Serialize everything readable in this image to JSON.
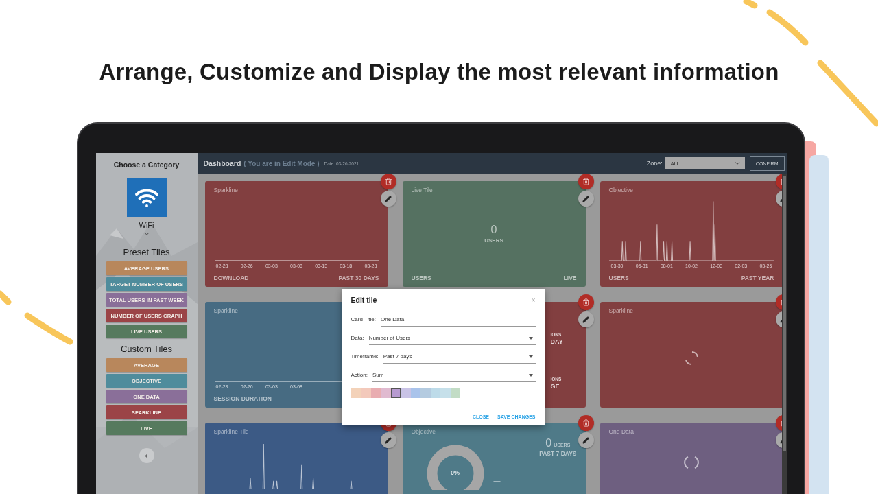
{
  "headline": "Arrange, Customize and Display the most relevant information",
  "sidebar": {
    "title": "Choose a Category",
    "category": "WiFi",
    "sections": [
      {
        "heading": "Preset Tiles",
        "tiles": [
          {
            "label": "AVERAGE USERS",
            "color": "#b8875c"
          },
          {
            "label": "TARGET NUMBER OF USERS",
            "color": "#4f8c9c"
          },
          {
            "label": "TOTAL USERS IN PAST WEEK",
            "color": "#8a6f99"
          },
          {
            "label": "NUMBER OF USERS GRAPH",
            "color": "#9b4447"
          },
          {
            "label": "LIVE USERS",
            "color": "#567a5e"
          }
        ]
      },
      {
        "heading": "Custom Tiles",
        "tiles": [
          {
            "label": "AVERAGE",
            "color": "#b8875c"
          },
          {
            "label": "OBJECTIVE",
            "color": "#4f8c9c"
          },
          {
            "label": "ONE DATA",
            "color": "#8a6f99"
          },
          {
            "label": "SPARKLINE",
            "color": "#9b4447"
          },
          {
            "label": "LIVE",
            "color": "#567a5e"
          }
        ]
      }
    ]
  },
  "header": {
    "title": "Dashboard",
    "mode_note": "( You are in Edit Mode )",
    "date": "Date: 03-26-2021",
    "zone_label": "Zone:",
    "zone_value": "ALL",
    "confirm": "CONFIRM"
  },
  "cards": [
    {
      "kind": "sparkline",
      "title": "Sparkline",
      "color": "#823f40",
      "dates": [
        "02-23",
        "02-26",
        "03-03",
        "03-08",
        "03-13",
        "03-18",
        "03-23"
      ],
      "footer_left": "DOWNLOAD",
      "footer_right": "PAST 30 DAYS"
    },
    {
      "kind": "live",
      "title": "Live Tile",
      "color": "#557161",
      "value": "0",
      "unit": "USERS",
      "footer_left": "USERS",
      "footer_right": "LIVE"
    },
    {
      "kind": "spikes",
      "title": "Objective",
      "color": "#823f40",
      "dates": [
        "03-30",
        "05-31",
        "08-01",
        "10-02",
        "12-03",
        "02-03",
        "03-25"
      ],
      "footer_left": "USERS",
      "footer_right": "PAST YEAR"
    },
    {
      "kind": "sparkline",
      "title": "Sparkline",
      "color": "#476b82",
      "dates": [
        "02-23",
        "02-26",
        "03-03",
        "03-08"
      ],
      "footer_left": "SESSION DURATION"
    },
    {
      "kind": "covered",
      "color": "#823f40",
      "lines": [
        {
          "kind": "caption",
          "text": "IONS"
        },
        {
          "kind": "value",
          "text": "DAY"
        },
        {
          "kind": "caption",
          "text": "IONS"
        },
        {
          "kind": "value",
          "text": "GE"
        }
      ]
    },
    {
      "kind": "loading",
      "title": "Sparkline",
      "color": "#823f40"
    },
    {
      "kind": "spikes",
      "title": "Sparkline Tile",
      "color": "#3c5a85"
    },
    {
      "kind": "objective",
      "title": "Objective",
      "color": "#4f7a88",
      "percent": "0%",
      "dash": "—",
      "value": "0",
      "unit": "USERS",
      "period": "PAST 7 DAYS"
    },
    {
      "kind": "loading-pair",
      "title": "One Data",
      "color": "#6e5f80"
    }
  ],
  "modal": {
    "title": "Edit tile",
    "close": "×",
    "fields": [
      {
        "kind": "text",
        "label": "Card Title:",
        "value": "One Data"
      },
      {
        "kind": "select",
        "label": "Data:",
        "value": "Number of Users"
      },
      {
        "kind": "select",
        "label": "Timeframe:",
        "value": "Past 7 days"
      },
      {
        "kind": "select",
        "label": "Action:",
        "value": "Sum"
      }
    ],
    "swatches": [
      {
        "color": "#f3d2b9",
        "selected": false
      },
      {
        "color": "#f3c9bb",
        "selected": false
      },
      {
        "color": "#e9adb1",
        "selected": false
      },
      {
        "color": "#e0bad0",
        "selected": false
      },
      {
        "color": "#b79ad0",
        "selected": true
      },
      {
        "color": "#c9c3e6",
        "selected": false
      },
      {
        "color": "#a9c3eb",
        "selected": false
      },
      {
        "color": "#b4cbe0",
        "selected": false
      },
      {
        "color": "#bddbe9",
        "selected": false
      },
      {
        "color": "#c6e0ea",
        "selected": false
      },
      {
        "color": "#c2dcc5",
        "selected": false
      }
    ],
    "buttons": [
      "CLOSE",
      "SAVE CHANGES"
    ]
  }
}
